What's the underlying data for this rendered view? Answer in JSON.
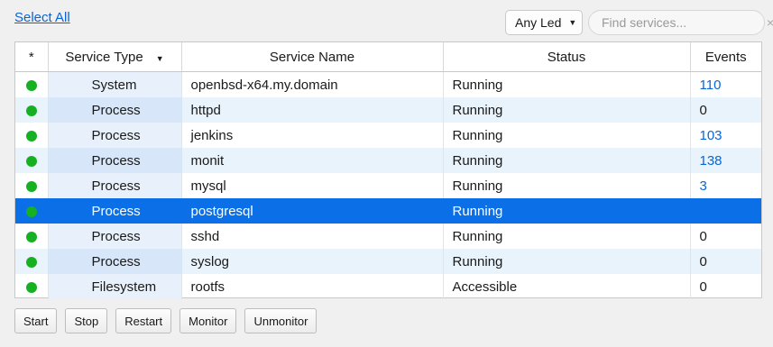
{
  "toolbar": {
    "select_all": "Select All",
    "led_filter": "Any Led",
    "search_placeholder": "Find services...",
    "clear_glyph": "×"
  },
  "table": {
    "columns": [
      "*",
      "Service Type",
      "Service Name",
      "Status",
      "Events"
    ],
    "rows": [
      {
        "type": "System",
        "name": "openbsd-x64.my.domain",
        "status": "Running",
        "events": "110",
        "led": "green"
      },
      {
        "type": "Process",
        "name": "httpd",
        "status": "Running",
        "events": "0",
        "led": "green"
      },
      {
        "type": "Process",
        "name": "jenkins",
        "status": "Running",
        "events": "103",
        "led": "green"
      },
      {
        "type": "Process",
        "name": "monit",
        "status": "Running",
        "events": "138",
        "led": "green"
      },
      {
        "type": "Process",
        "name": "mysql",
        "status": "Running",
        "events": "3",
        "led": "green"
      },
      {
        "type": "Process",
        "name": "postgresql",
        "status": "Running",
        "events": "",
        "led": "green",
        "selected": true
      },
      {
        "type": "Process",
        "name": "sshd",
        "status": "Running",
        "events": "0",
        "led": "green"
      },
      {
        "type": "Process",
        "name": "syslog",
        "status": "Running",
        "events": "0",
        "led": "green"
      },
      {
        "type": "Filesystem",
        "name": "rootfs",
        "status": "Accessible",
        "events": "0",
        "led": "green"
      }
    ]
  },
  "actions": {
    "start": "Start",
    "stop": "Stop",
    "restart": "Restart",
    "monitor": "Monitor",
    "unmonitor": "Unmonitor"
  },
  "colors": {
    "accent": "#0b6fe8",
    "led_green": "#16b023",
    "link": "#0a64d6"
  }
}
